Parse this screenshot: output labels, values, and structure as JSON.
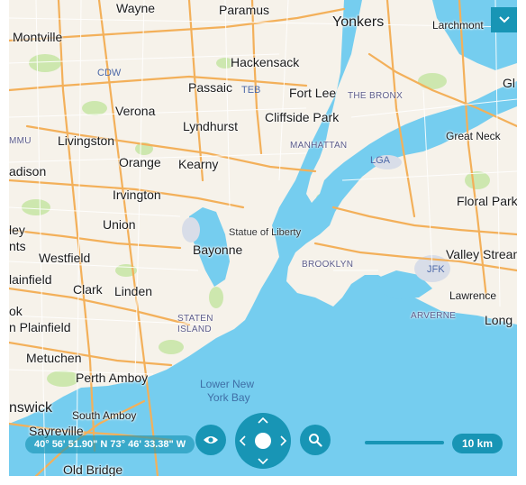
{
  "map": {
    "cities": {
      "wayne": "Wayne",
      "paramus": "Paramus",
      "yonkers": "Yonkers",
      "larchmont": "Larchmont",
      "gl": "Gl",
      "montville": "Montville",
      "hackensack": "Hackensack",
      "passaic": "Passaic",
      "fort_lee": "Fort Lee",
      "verona": "Verona",
      "lyndhurst": "Lyndhurst",
      "cliffside_park": "Cliffside Park",
      "livingston": "Livingston",
      "great_neck": "Great Neck",
      "adison": "adison",
      "orange": "Orange",
      "kearny": "Kearny",
      "irvington": "Irvington",
      "floral_park": "Floral Park",
      "ley": "ley",
      "nts": "nts",
      "union": "Union",
      "bayonne": "Bayonne",
      "valley_stream": "Valley Strean",
      "westfield": "Westfield",
      "lainfield": "lainfield",
      "clark": "Clark",
      "linden": "Linden",
      "lawrence": "Lawrence",
      "ok": "ok",
      "long": "Long",
      "n_plainfield": "n Plainfield",
      "metuchen": "Metuchen",
      "perth_amboy": "Perth Amboy",
      "nswick": "nswick",
      "south_amboy": "South Amboy",
      "sayreville": "Sayreville",
      "old_bridge": "Old Bridge"
    },
    "districts": {
      "the_bronx": "THE BRONX",
      "manhattan": "MANHATTAN",
      "brooklyn": "BROOKLYN",
      "arverne": "ARVERNE",
      "staten_island_1": "STATEN",
      "staten_island_2": "ISLAND",
      "mmu": "MMU"
    },
    "airports": {
      "cdw": "CDW",
      "teb": "TEB",
      "lga": "LGA",
      "jfk": "JFK"
    },
    "poi": {
      "statue_of_liberty": "Statue of Liberty"
    },
    "water": {
      "lower_ny_bay_1": "Lower New",
      "lower_ny_bay_2": "York Bay"
    }
  },
  "controls": {
    "coordinates": "40° 56' 51.90\" N 73° 46' 33.38\" W",
    "scale": "10 km",
    "icons": {
      "visibility": "eye-icon",
      "search": "search-icon",
      "collapse": "chevron-down-icon",
      "pan_up": "chevron-up-icon",
      "pan_down": "chevron-down-icon",
      "pan_left": "chevron-left-icon",
      "pan_right": "chevron-right-icon"
    },
    "accent_color": "#1895b5"
  }
}
